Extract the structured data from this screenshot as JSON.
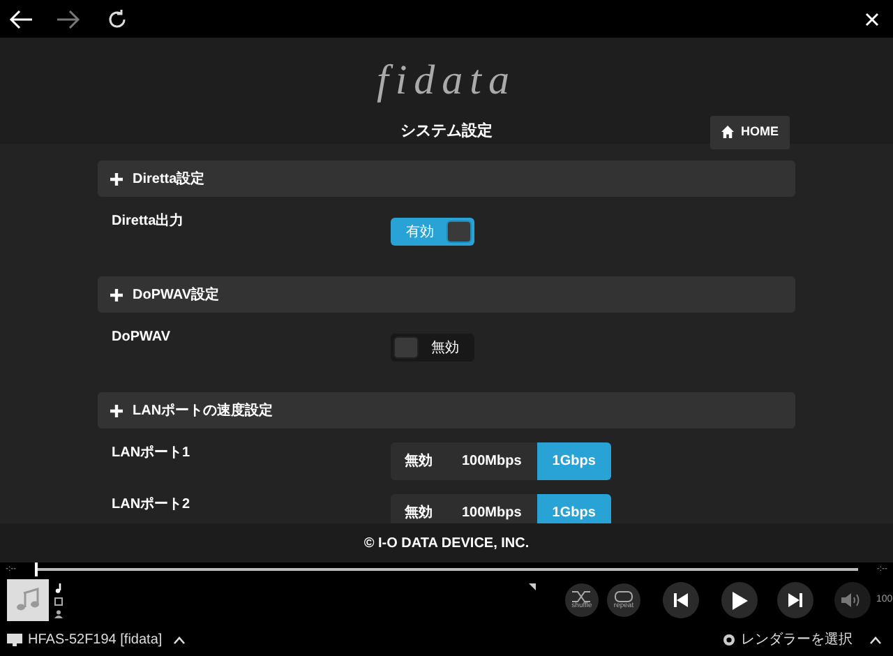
{
  "header": {
    "logo": "fidata",
    "title": "システム設定",
    "home_button": "HOME"
  },
  "sections": [
    {
      "title": "Diretta設定",
      "rows": [
        {
          "kind": "toggle",
          "label": "Diretta出力",
          "on": true,
          "value_label": "有効"
        }
      ]
    },
    {
      "title": "DoPWAV設定",
      "rows": [
        {
          "kind": "toggle",
          "label": "DoPWAV",
          "on": false,
          "value_label": "無効"
        }
      ]
    },
    {
      "title": "LANポートの速度設定",
      "rows": [
        {
          "kind": "segmented",
          "label": "LANポート1",
          "options": [
            {
              "label": "無効",
              "selected": false
            },
            {
              "label": "100Mbps",
              "selected": false
            },
            {
              "label": "1Gbps",
              "selected": true
            }
          ]
        },
        {
          "kind": "segmented",
          "label": "LANポート2",
          "options": [
            {
              "label": "無効",
              "selected": false
            },
            {
              "label": "100Mbps",
              "selected": false
            },
            {
              "label": "1Gbps",
              "selected": true
            }
          ]
        }
      ]
    }
  ],
  "footer": "© I-O DATA DEVICE, INC.",
  "player": {
    "elapsed": "-:--",
    "remaining": "-:--",
    "level": 0,
    "shuffle_label": "shuffle",
    "repeat_label": "repeat",
    "volume": "100",
    "device": "HFAS-52F194 [fidata]",
    "renderer": "レンダラーを選択"
  }
}
